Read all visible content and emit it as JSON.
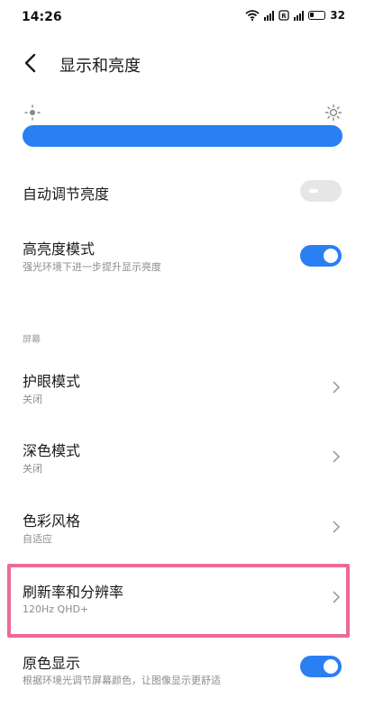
{
  "status_bar": {
    "time": "14:26",
    "battery": "32"
  },
  "header": {
    "title": "显示和亮度"
  },
  "brightness": {
    "level": 1.0
  },
  "auto_brightness": {
    "label": "自动调节亮度",
    "enabled": false
  },
  "high_brightness": {
    "label": "高亮度模式",
    "subtitle": "强光环境下进一步提升显示亮度",
    "enabled": true
  },
  "section": {
    "label": "屏幕"
  },
  "items": [
    {
      "label": "护眼模式",
      "value": "关闭"
    },
    {
      "label": "深色模式",
      "value": "关闭"
    },
    {
      "label": "色彩风格",
      "value": "自适应"
    },
    {
      "label": "刷新率和分辨率",
      "value": "120Hz  QHD+"
    }
  ],
  "original_color": {
    "label": "原色显示",
    "subtitle": "根据环境光调节屏幕颜色，让图像显示更舒适",
    "enabled": true
  },
  "colors": {
    "accent": "#2a7ff3",
    "highlight": "#ec6a97"
  }
}
